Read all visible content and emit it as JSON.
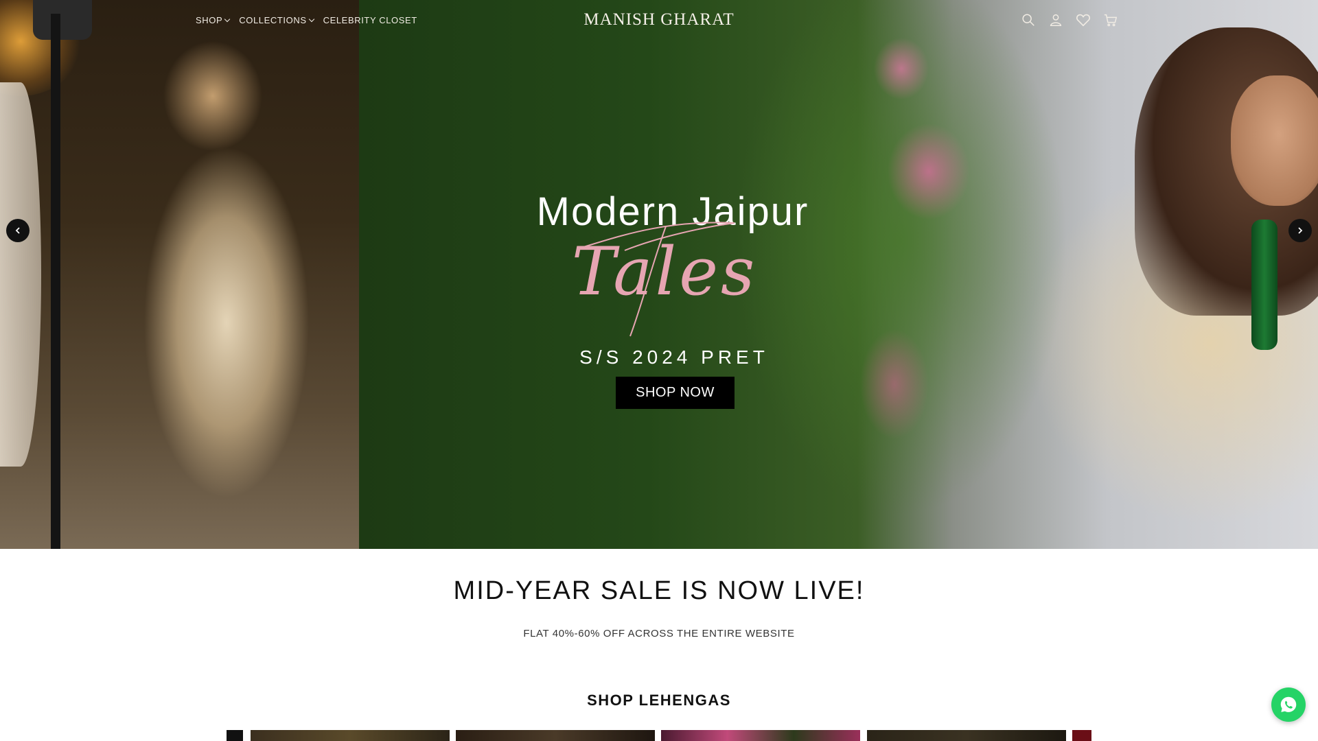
{
  "nav": {
    "items": [
      {
        "label": "SHOP",
        "has_dropdown": true
      },
      {
        "label": "COLLECTIONS",
        "has_dropdown": true
      },
      {
        "label": "CELEBRITY CLOSET",
        "has_dropdown": false
      }
    ],
    "logo": "MANISH GHARAT",
    "icons": [
      "search-icon",
      "account-icon",
      "wishlist-icon",
      "cart-icon"
    ]
  },
  "hero": {
    "title": "Modern Jaipur",
    "script": "Tales",
    "subtitle": "S/S 2024 PRET",
    "cta": "SHOP NOW",
    "prev_icon": "chevron-left-icon",
    "next_icon": "chevron-right-icon"
  },
  "sale": {
    "title": "MID-YEAR SALE IS NOW LIVE!",
    "subtitle": "FLAT 40%-60% OFF ACROSS THE ENTIRE WEBSITE"
  },
  "lehengas": {
    "title": "SHOP LEHENGAS"
  },
  "colors": {
    "accent_script": "#e6a5b2",
    "button_bg": "#000000",
    "whatsapp": "#25d366"
  }
}
